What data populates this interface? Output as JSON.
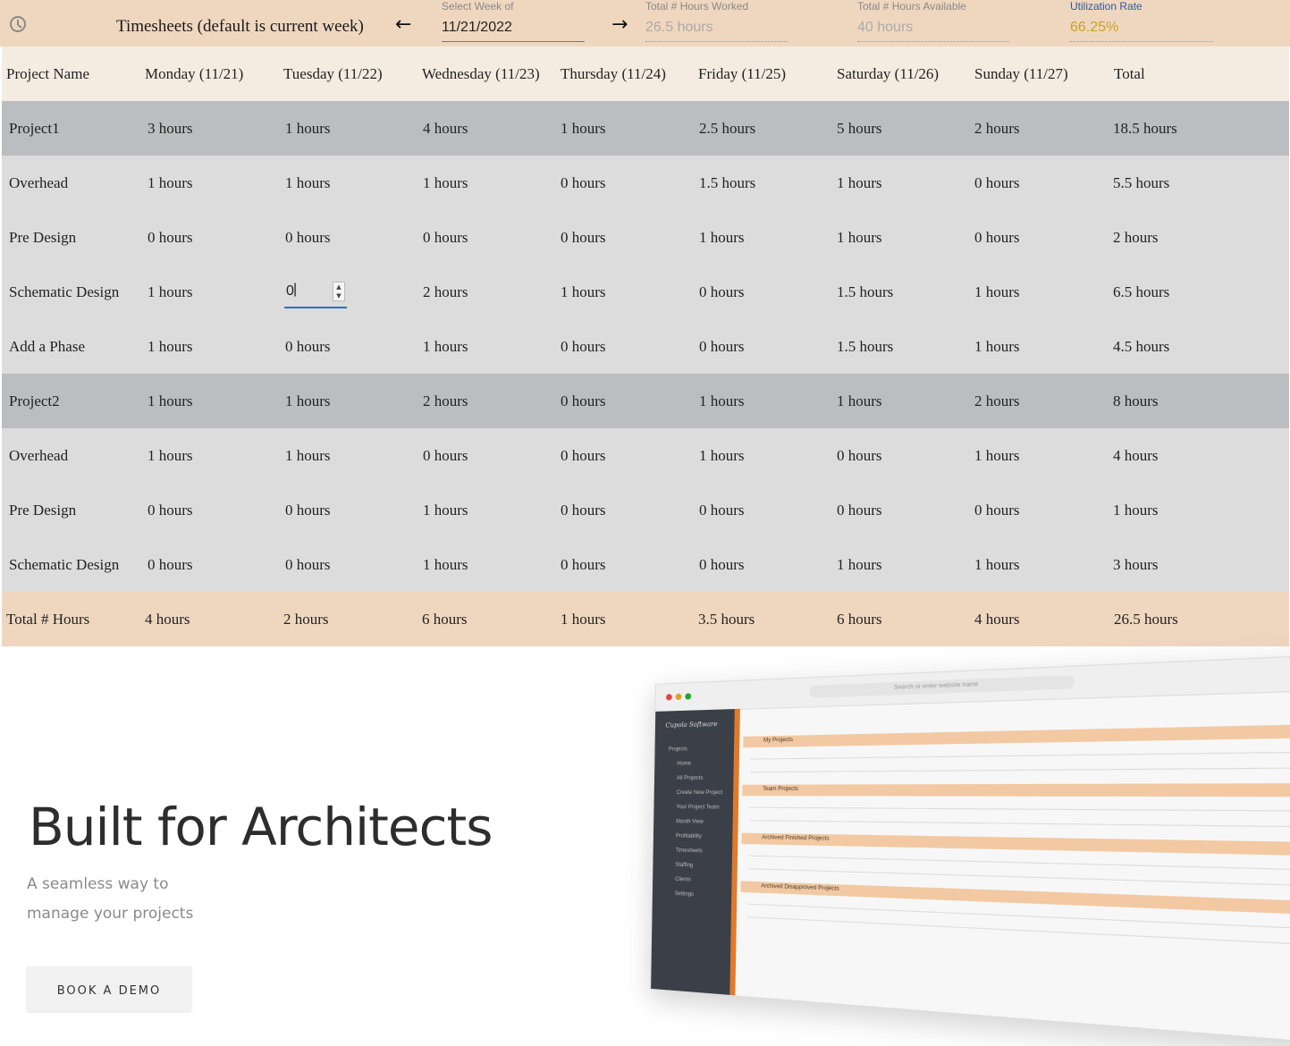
{
  "header": {
    "title": "Timesheets (default is current week)",
    "prev_arrow": "←",
    "next_arrow": "→",
    "week": {
      "label": "Select Week of",
      "value": "11/21/2022"
    },
    "worked": {
      "label": "Total # Hours Worked",
      "value": "26.5 hours"
    },
    "available": {
      "label": "Total # Hours Available",
      "value": "40 hours"
    },
    "utilization": {
      "label": "Utilization Rate",
      "value": "66.25%"
    },
    "colors": {
      "bar": "#efd7bf",
      "utilization_label": "#2c5a9a",
      "utilization_value": "#c9a227"
    }
  },
  "table": {
    "columns": [
      "Project Name",
      "Monday (11/21)",
      "Tuesday (11/22)",
      "Wednesday (11/23)",
      "Thursday (11/24)",
      "Friday (11/25)",
      "Saturday (11/26)",
      "Sunday (11/27)",
      "Total"
    ],
    "rows": [
      {
        "type": "project",
        "cells": [
          "Project1",
          "3 hours",
          "1 hours",
          "4 hours",
          "1 hours",
          "2.5 hours",
          "5 hours",
          "2 hours",
          "18.5 hours"
        ]
      },
      {
        "type": "phase",
        "cells": [
          "Overhead",
          "1 hours",
          "1 hours",
          "1 hours",
          "0 hours",
          "1.5 hours",
          "1 hours",
          "0 hours",
          "5.5 hours"
        ]
      },
      {
        "type": "phase",
        "cells": [
          "Pre Design",
          "0 hours",
          "0 hours",
          "0 hours",
          "0 hours",
          "1 hours",
          "1 hours",
          "0 hours",
          "2 hours"
        ]
      },
      {
        "type": "phase",
        "cells": [
          "Schematic Design",
          "1 hours",
          "0",
          "2 hours",
          "1 hours",
          "0 hours",
          "1.5 hours",
          "1 hours",
          "6.5 hours"
        ]
      },
      {
        "type": "phase",
        "cells": [
          "Add a Phase",
          "1 hours",
          "0 hours",
          "1 hours",
          "0 hours",
          "0 hours",
          "1.5 hours",
          "1 hours",
          "4.5 hours"
        ]
      },
      {
        "type": "project",
        "cells": [
          "Project2",
          "1 hours",
          "1 hours",
          "2 hours",
          "0 hours",
          "1 hours",
          "1 hours",
          "2 hours",
          "8 hours"
        ]
      },
      {
        "type": "phase",
        "cells": [
          "Overhead",
          "1 hours",
          "1 hours",
          "0 hours",
          "0 hours",
          "1 hours",
          "0 hours",
          "1 hours",
          "4 hours"
        ]
      },
      {
        "type": "phase",
        "cells": [
          "Pre Design",
          "0 hours",
          "0 hours",
          "1 hours",
          "0 hours",
          "0 hours",
          "0 hours",
          "0 hours",
          "1 hours"
        ]
      },
      {
        "type": "phase",
        "cells": [
          "Schematic Design",
          "0 hours",
          "0 hours",
          "1 hours",
          "0 hours",
          "0 hours",
          "1 hours",
          "1 hours",
          "3 hours"
        ]
      }
    ],
    "footer": [
      "Total # Hours",
      "4 hours",
      "2 hours",
      "6 hours",
      "1 hours",
      "3.5 hours",
      "6 hours",
      "4 hours",
      "26.5 hours"
    ],
    "editing": {
      "row": 3,
      "col": 2,
      "value": "0"
    }
  },
  "promo": {
    "headline": "Built for Architects",
    "subline_1": "A seamless way to",
    "subline_2": "manage your projects",
    "cta": "BOOK A DEMO",
    "mockup": {
      "brand": "Cupola Software",
      "search": "Search or enter website name",
      "nav": [
        "Projects",
        "Home",
        "All Projects",
        "Create New Project",
        "Your Project Team",
        "Month View",
        "Profitability",
        "Timesheets",
        "Staffing",
        "Clients",
        "Settings"
      ],
      "sections": [
        "My Projects",
        "Team Projects",
        "Archived Finished Projects",
        "Archived Disapproved Projects"
      ]
    }
  }
}
